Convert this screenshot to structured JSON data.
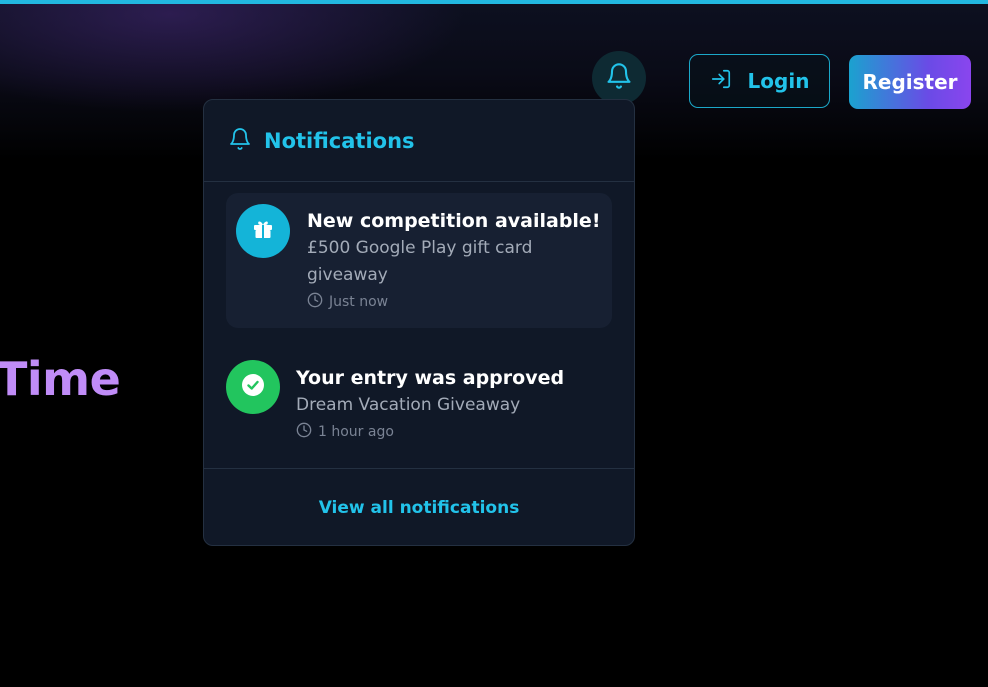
{
  "header": {
    "login_label": "Login",
    "register_label": "Register"
  },
  "hero": {
    "partial_heading": "Time"
  },
  "notifications": {
    "title": "Notifications",
    "items": [
      {
        "icon": "gift-icon",
        "icon_color": "#14b4d8",
        "title": "New competition available!",
        "body": "£500 Google Play gift card giveaway",
        "time": "Just now"
      },
      {
        "icon": "check-circle-icon",
        "icon_color": "#22c55e",
        "title": "Your entry was approved",
        "body": "Dream Vacation Giveaway",
        "time": "1 hour ago"
      }
    ],
    "view_all_label": "View all notifications"
  },
  "colors": {
    "accent": "#22c3ea",
    "hero_text": "#c08cf7",
    "success": "#22c55e"
  }
}
